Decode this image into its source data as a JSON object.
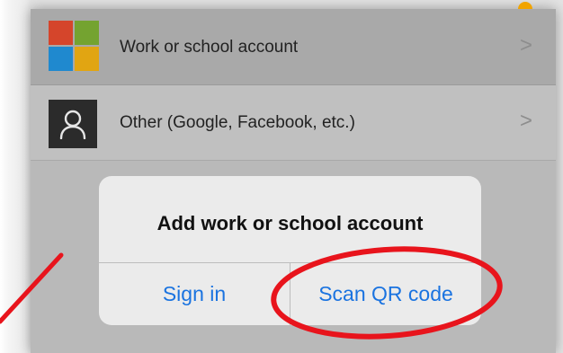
{
  "accounts": [
    {
      "label": "Work or school account",
      "icon": "microsoft-logo-icon"
    },
    {
      "label": "Other (Google, Facebook, etc.)",
      "icon": "person-icon"
    }
  ],
  "chevron": ">",
  "dialog": {
    "title": "Add work or school account",
    "sign_in_label": "Sign in",
    "scan_qr_label": "Scan QR code"
  },
  "colors": {
    "annotation": "#e8141c",
    "ios_blue": "#1a73e0",
    "ms_red": "#d5452b",
    "ms_green": "#74a330",
    "ms_blue": "#1f89cf",
    "ms_yellow": "#e1a512"
  }
}
